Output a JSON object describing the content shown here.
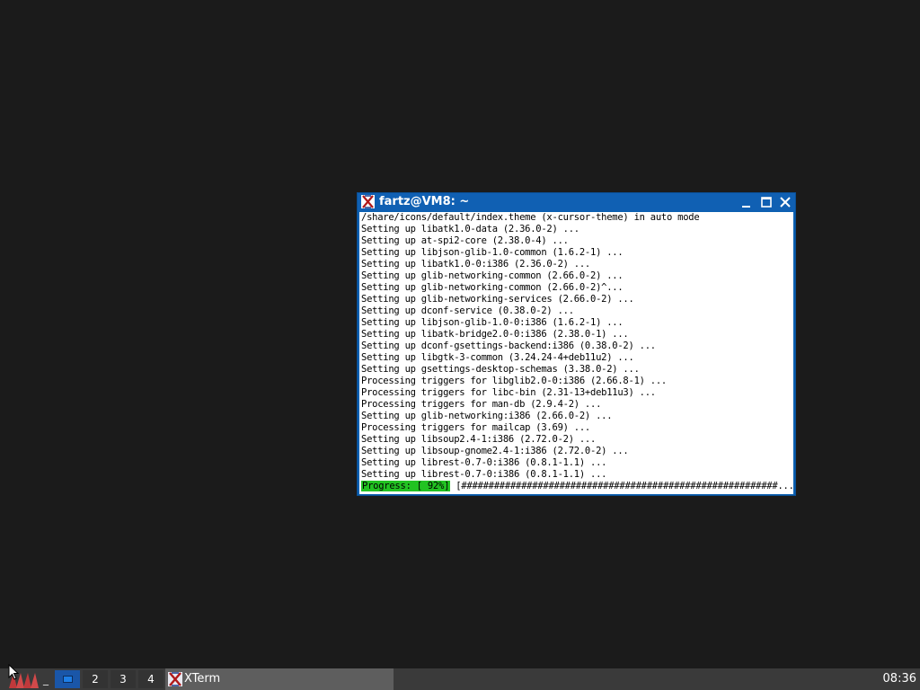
{
  "window": {
    "title": "fartz@VM8: ~",
    "icon": "xterm-icon",
    "controls": {
      "minimize": "minimize-icon",
      "maximize": "maximize-icon",
      "close": "close-icon"
    }
  },
  "terminal": {
    "lines": [
      "/share/icons/default/index.theme (x-cursor-theme) in auto mode",
      "Setting up libatk1.0-data (2.36.0-2) ...",
      "Setting up at-spi2-core (2.38.0-4) ...",
      "Setting up libjson-glib-1.0-common (1.6.2-1) ...",
      "Setting up libatk1.0-0:i386 (2.36.0-2) ...",
      "Setting up glib-networking-common (2.66.0-2) ...",
      "Setting up glib-networking-common (2.66.0-2)^...",
      "Setting up glib-networking-services (2.66.0-2) ...",
      "Setting up dconf-service (0.38.0-2) ...",
      "Setting up libjson-glib-1.0-0:i386 (1.6.2-1) ...",
      "Setting up libatk-bridge2.0-0:i386 (2.38.0-1) ...",
      "Setting up dconf-gsettings-backend:i386 (0.38.0-2) ...",
      "Setting up libgtk-3-common (3.24.24-4+deb11u2) ...",
      "Setting up gsettings-desktop-schemas (3.38.0-2) ...",
      "Processing triggers for libglib2.0-0:i386 (2.66.8-1) ...",
      "Processing triggers for libc-bin (2.31-13+deb11u3) ...",
      "Processing triggers for man-db (2.9.4-2) ...",
      "Setting up glib-networking:i386 (2.66.0-2) ...",
      "Processing triggers for mailcap (3.69) ...",
      "Setting up libsoup2.4-1:i386 (2.72.0-2) ...",
      "Setting up libsoup-gnome2.4-1:i386 (2.72.0-2) ...",
      "Setting up librest-0.7-0:i386 (0.8.1-1.1) ...",
      "Setting up librest-0.7-0:i386 (0.8.1-1.1) ..."
    ],
    "progress": {
      "label": "Progress: [ 92%]",
      "bar": " [##########################################################.....]",
      "percent": 92
    }
  },
  "taskbar": {
    "start_icon": "start-menu-icon",
    "show_desktop_label": "_",
    "workspaces": [
      "1",
      "2",
      "3",
      "4"
    ],
    "active_workspace": "1",
    "tasks": [
      {
        "label": "XTerm",
        "icon": "xterm-icon"
      }
    ],
    "clock": "08:36"
  },
  "colors": {
    "desktop": "#1b1b1b",
    "titlebar": "#1060b3",
    "progress_highlight": "#22c322",
    "taskbar": "#3a3a3a",
    "active_workspace": "#1a56a8"
  }
}
